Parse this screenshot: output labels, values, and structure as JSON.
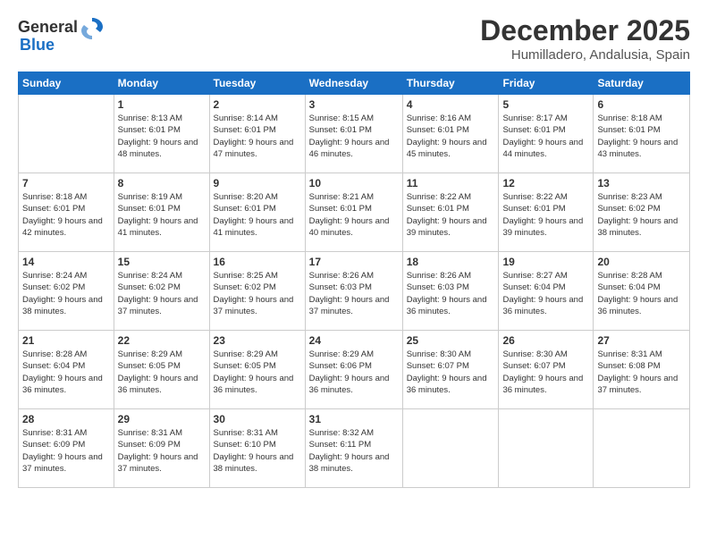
{
  "logo": {
    "text_general": "General",
    "text_blue": "Blue"
  },
  "title": {
    "month": "December 2025",
    "location": "Humilladero, Andalusia, Spain"
  },
  "calendar": {
    "headers": [
      "Sunday",
      "Monday",
      "Tuesday",
      "Wednesday",
      "Thursday",
      "Friday",
      "Saturday"
    ],
    "weeks": [
      [
        {
          "day": "",
          "sunrise": "",
          "sunset": "",
          "daylight": ""
        },
        {
          "day": "1",
          "sunrise": "Sunrise: 8:13 AM",
          "sunset": "Sunset: 6:01 PM",
          "daylight": "Daylight: 9 hours and 48 minutes."
        },
        {
          "day": "2",
          "sunrise": "Sunrise: 8:14 AM",
          "sunset": "Sunset: 6:01 PM",
          "daylight": "Daylight: 9 hours and 47 minutes."
        },
        {
          "day": "3",
          "sunrise": "Sunrise: 8:15 AM",
          "sunset": "Sunset: 6:01 PM",
          "daylight": "Daylight: 9 hours and 46 minutes."
        },
        {
          "day": "4",
          "sunrise": "Sunrise: 8:16 AM",
          "sunset": "Sunset: 6:01 PM",
          "daylight": "Daylight: 9 hours and 45 minutes."
        },
        {
          "day": "5",
          "sunrise": "Sunrise: 8:17 AM",
          "sunset": "Sunset: 6:01 PM",
          "daylight": "Daylight: 9 hours and 44 minutes."
        },
        {
          "day": "6",
          "sunrise": "Sunrise: 8:18 AM",
          "sunset": "Sunset: 6:01 PM",
          "daylight": "Daylight: 9 hours and 43 minutes."
        }
      ],
      [
        {
          "day": "7",
          "sunrise": "Sunrise: 8:18 AM",
          "sunset": "Sunset: 6:01 PM",
          "daylight": "Daylight: 9 hours and 42 minutes."
        },
        {
          "day": "8",
          "sunrise": "Sunrise: 8:19 AM",
          "sunset": "Sunset: 6:01 PM",
          "daylight": "Daylight: 9 hours and 41 minutes."
        },
        {
          "day": "9",
          "sunrise": "Sunrise: 8:20 AM",
          "sunset": "Sunset: 6:01 PM",
          "daylight": "Daylight: 9 hours and 41 minutes."
        },
        {
          "day": "10",
          "sunrise": "Sunrise: 8:21 AM",
          "sunset": "Sunset: 6:01 PM",
          "daylight": "Daylight: 9 hours and 40 minutes."
        },
        {
          "day": "11",
          "sunrise": "Sunrise: 8:22 AM",
          "sunset": "Sunset: 6:01 PM",
          "daylight": "Daylight: 9 hours and 39 minutes."
        },
        {
          "day": "12",
          "sunrise": "Sunrise: 8:22 AM",
          "sunset": "Sunset: 6:01 PM",
          "daylight": "Daylight: 9 hours and 39 minutes."
        },
        {
          "day": "13",
          "sunrise": "Sunrise: 8:23 AM",
          "sunset": "Sunset: 6:02 PM",
          "daylight": "Daylight: 9 hours and 38 minutes."
        }
      ],
      [
        {
          "day": "14",
          "sunrise": "Sunrise: 8:24 AM",
          "sunset": "Sunset: 6:02 PM",
          "daylight": "Daylight: 9 hours and 38 minutes."
        },
        {
          "day": "15",
          "sunrise": "Sunrise: 8:24 AM",
          "sunset": "Sunset: 6:02 PM",
          "daylight": "Daylight: 9 hours and 37 minutes."
        },
        {
          "day": "16",
          "sunrise": "Sunrise: 8:25 AM",
          "sunset": "Sunset: 6:02 PM",
          "daylight": "Daylight: 9 hours and 37 minutes."
        },
        {
          "day": "17",
          "sunrise": "Sunrise: 8:26 AM",
          "sunset": "Sunset: 6:03 PM",
          "daylight": "Daylight: 9 hours and 37 minutes."
        },
        {
          "day": "18",
          "sunrise": "Sunrise: 8:26 AM",
          "sunset": "Sunset: 6:03 PM",
          "daylight": "Daylight: 9 hours and 36 minutes."
        },
        {
          "day": "19",
          "sunrise": "Sunrise: 8:27 AM",
          "sunset": "Sunset: 6:04 PM",
          "daylight": "Daylight: 9 hours and 36 minutes."
        },
        {
          "day": "20",
          "sunrise": "Sunrise: 8:28 AM",
          "sunset": "Sunset: 6:04 PM",
          "daylight": "Daylight: 9 hours and 36 minutes."
        }
      ],
      [
        {
          "day": "21",
          "sunrise": "Sunrise: 8:28 AM",
          "sunset": "Sunset: 6:04 PM",
          "daylight": "Daylight: 9 hours and 36 minutes."
        },
        {
          "day": "22",
          "sunrise": "Sunrise: 8:29 AM",
          "sunset": "Sunset: 6:05 PM",
          "daylight": "Daylight: 9 hours and 36 minutes."
        },
        {
          "day": "23",
          "sunrise": "Sunrise: 8:29 AM",
          "sunset": "Sunset: 6:05 PM",
          "daylight": "Daylight: 9 hours and 36 minutes."
        },
        {
          "day": "24",
          "sunrise": "Sunrise: 8:29 AM",
          "sunset": "Sunset: 6:06 PM",
          "daylight": "Daylight: 9 hours and 36 minutes."
        },
        {
          "day": "25",
          "sunrise": "Sunrise: 8:30 AM",
          "sunset": "Sunset: 6:07 PM",
          "daylight": "Daylight: 9 hours and 36 minutes."
        },
        {
          "day": "26",
          "sunrise": "Sunrise: 8:30 AM",
          "sunset": "Sunset: 6:07 PM",
          "daylight": "Daylight: 9 hours and 36 minutes."
        },
        {
          "day": "27",
          "sunrise": "Sunrise: 8:31 AM",
          "sunset": "Sunset: 6:08 PM",
          "daylight": "Daylight: 9 hours and 37 minutes."
        }
      ],
      [
        {
          "day": "28",
          "sunrise": "Sunrise: 8:31 AM",
          "sunset": "Sunset: 6:09 PM",
          "daylight": "Daylight: 9 hours and 37 minutes."
        },
        {
          "day": "29",
          "sunrise": "Sunrise: 8:31 AM",
          "sunset": "Sunset: 6:09 PM",
          "daylight": "Daylight: 9 hours and 37 minutes."
        },
        {
          "day": "30",
          "sunrise": "Sunrise: 8:31 AM",
          "sunset": "Sunset: 6:10 PM",
          "daylight": "Daylight: 9 hours and 38 minutes."
        },
        {
          "day": "31",
          "sunrise": "Sunrise: 8:32 AM",
          "sunset": "Sunset: 6:11 PM",
          "daylight": "Daylight: 9 hours and 38 minutes."
        },
        {
          "day": "",
          "sunrise": "",
          "sunset": "",
          "daylight": ""
        },
        {
          "day": "",
          "sunrise": "",
          "sunset": "",
          "daylight": ""
        },
        {
          "day": "",
          "sunrise": "",
          "sunset": "",
          "daylight": ""
        }
      ]
    ]
  }
}
